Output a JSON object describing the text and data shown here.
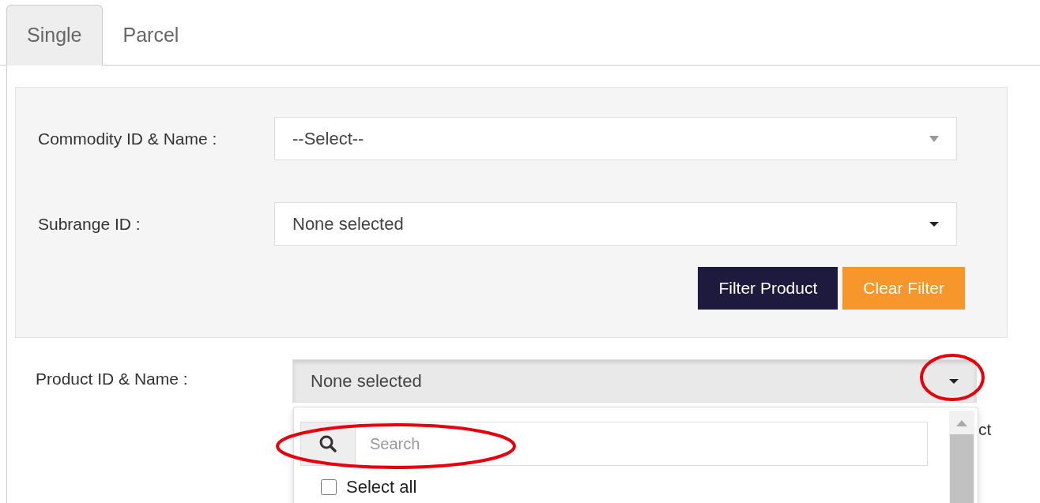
{
  "tabs": [
    {
      "label": "Single",
      "selected": true
    },
    {
      "label": "Parcel",
      "selected": false
    }
  ],
  "filter_panel": {
    "fields": [
      {
        "kind": "select",
        "label": "Commodity ID & Name :",
        "value": "--Select--"
      },
      {
        "kind": "multiselect",
        "label": "Subrange ID :",
        "value": "None selected"
      }
    ],
    "buttons": [
      {
        "label": "Filter Product",
        "kind": "primary"
      },
      {
        "label": "Clear Filter",
        "kind": "warning"
      }
    ]
  },
  "product_field": {
    "label": "Product ID & Name :",
    "value": "None selected",
    "expanded": true,
    "hidden_text": "ct",
    "dropdown": {
      "search": {
        "placeholder": "Search"
      },
      "options": [
        {
          "label": "Select all",
          "checked": false
        }
      ]
    }
  }
}
